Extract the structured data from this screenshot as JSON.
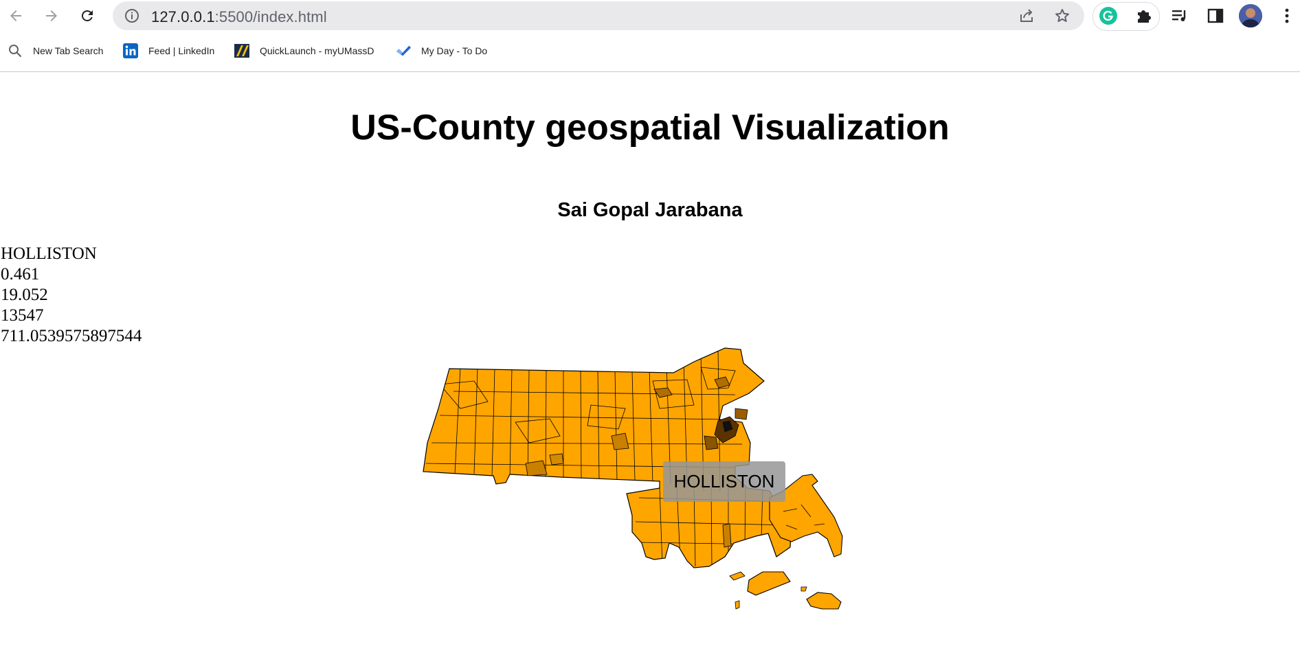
{
  "browser": {
    "url_host": "127.0.0.1",
    "url_rest": ":5500/index.html",
    "bookmarks": [
      {
        "label": "New Tab Search",
        "icon": "search-icon"
      },
      {
        "label": "Feed | LinkedIn",
        "icon": "linkedin-icon"
      },
      {
        "label": "QuickLaunch - myUMassD",
        "icon": "umassd-icon"
      },
      {
        "label": "My Day - To Do",
        "icon": "todo-check-icon"
      }
    ],
    "colors": {
      "grammarly": "#15c39a",
      "linkedin": "#0a66c2",
      "todo": "#2564cf"
    }
  },
  "page": {
    "title": "US-County geospatial Visualization",
    "author": "Sai Gopal Jarabana",
    "info": {
      "name": "HOLLISTON",
      "value1": "0.461",
      "value2": "19.052",
      "value3": "13547",
      "value4": "711.0539575897544"
    },
    "tooltip": "HOLLISTON",
    "map_colors": {
      "base": "#ffa500",
      "dark": "#3a2200",
      "stroke": "#000000"
    }
  }
}
